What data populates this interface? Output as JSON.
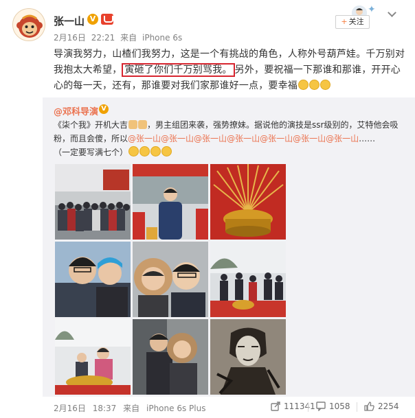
{
  "author": {
    "name": "张一山",
    "verified_mark": "V",
    "meta": {
      "date": "2月16日",
      "time": "22:21",
      "source_prefix": "来自",
      "source": "iPhone 6s"
    },
    "follow_label": "关注",
    "follow_icon": "+"
  },
  "post": {
    "text_before": "导演我努力，山楂们我努力，这是一个有挑战的角色，人称外号葫芦娃。千万别对我抱太大希望，",
    "text_highlight": "寅砸了你们千万别骂我。",
    "text_after": "另外，要祝福一下那谁和那谁，开开心心的每一天，还有，那谁要对我们家那谁好一点，要幸福",
    "emoji_count": 3
  },
  "repost": {
    "author": "@邓科导演",
    "verified_mark": "V",
    "text_part1": "《柒个我》开机大吉",
    "text_part2": "，男主组团来袭，强势撩妹。据说他的演技是ssr级别的，艾特他会吸粉，而且会傻，所以",
    "mentions": [
      "@张一山",
      "@张一山",
      "@张一山",
      "@张一山",
      "@张一山",
      "@张一山",
      "@张一山"
    ],
    "ellipsis": "……",
    "text_part3": "（一定要写满七个）",
    "photos": [
      {
        "id": "group-photo"
      },
      {
        "id": "ceremony-host"
      },
      {
        "id": "golden-incense"
      },
      {
        "id": "selfie-two-men"
      },
      {
        "id": "selfie-hooded"
      },
      {
        "id": "ceremony-crowd"
      },
      {
        "id": "incense-offering"
      },
      {
        "id": "hooded-couple"
      },
      {
        "id": "sketch-portrait"
      }
    ]
  },
  "footer": {
    "date": "2月16日",
    "time": "18:37",
    "source_prefix": "来自",
    "source": "iPhone 6s Plus",
    "reposts": "111341",
    "comments": "1058",
    "likes": "2254"
  },
  "colors": {
    "accent_orange": "#eb7350",
    "highlight_border": "#d7242e",
    "repost_bg": "#f2f2f5",
    "meta_gray": "#808080"
  }
}
